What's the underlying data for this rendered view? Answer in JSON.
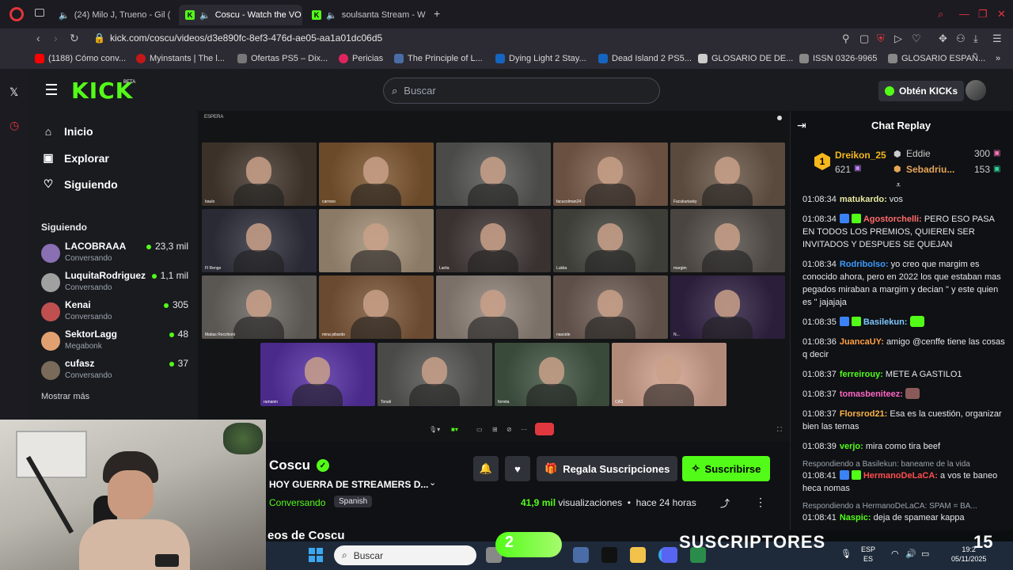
{
  "browser": {
    "tabs": [
      {
        "label": "(24) Milo J, Trueno - Gil (",
        "icon": "youtube-icon"
      },
      {
        "label": "Coscu - Watch the VO",
        "icon": "kick-icon",
        "active": true
      },
      {
        "label": "soulsanta Stream - W",
        "icon": "kick-icon"
      }
    ],
    "new_tab": "+",
    "url": "kick.com/coscu/videos/d3e890fc-8ef3-476d-ae05-aa1a01dc06d5",
    "bookmarks": [
      {
        "label": "(1188) Cómo conv...",
        "color": "#ff0000"
      },
      {
        "label": "Myinstants | The l...",
        "color": "#c41818"
      },
      {
        "label": "Ofertas PS5 – Dix...",
        "color": "#777777"
      },
      {
        "label": "Pericias",
        "color": "#e0245e"
      },
      {
        "label": "The Principle of L...",
        "color": "#4a6da7"
      },
      {
        "label": "Dying Light 2 Stay...",
        "color": "#1565c0"
      },
      {
        "label": "Dead Island 2 PS5...",
        "color": "#1565c0"
      },
      {
        "label": "GLOSARIO DE DE...",
        "color": "#cccccc"
      },
      {
        "label": "ISSN 0326-9965",
        "color": "#888888"
      },
      {
        "label": "GLOSARIO ESPAÑ...",
        "color": "#888888"
      }
    ]
  },
  "kick": {
    "logo": "KICK",
    "beta": "BETA",
    "search_placeholder": "Buscar",
    "get_kicks": "Obtén KICKs",
    "nav": [
      {
        "label": "Inicio",
        "icon": "home-icon"
      },
      {
        "label": "Explorar",
        "icon": "explore-icon"
      },
      {
        "label": "Siguiendo",
        "icon": "heart-icon"
      }
    ],
    "following_label": "Siguiendo",
    "following": [
      {
        "name": "LACOBRAAA",
        "status": "Conversando",
        "viewers": "23,3 mil",
        "color": "#8a6fb2"
      },
      {
        "name": "LuquitaRodriguez",
        "status": "Conversando",
        "viewers": "1,1 mil",
        "color": "#a0a0a0"
      },
      {
        "name": "Kenai",
        "status": "Conversando",
        "viewers": "305",
        "color": "#c05050"
      },
      {
        "name": "SektorLagg",
        "status": "Megabonk",
        "viewers": "48",
        "color": "#e0a070"
      },
      {
        "name": "cufasz",
        "status": "Conversando",
        "viewers": "37",
        "color": "#7a6a5a"
      }
    ],
    "show_more": "Mostrar más"
  },
  "video": {
    "status": "ESPERA",
    "cams": [
      {
        "label": "baulo",
        "color": "#3b3128"
      },
      {
        "label": "carrooo",
        "color": "#6b4a2a"
      },
      {
        "label": "",
        "color": "#4a4a48"
      },
      {
        "label": "facucolman24",
        "color": "#6a5040"
      },
      {
        "label": "Facukuriasky",
        "color": "#5a4a3e"
      },
      {
        "label": "Fl Rengo",
        "color": "#2a2a35"
      },
      {
        "label": "",
        "color": "#8a7a66"
      },
      {
        "label": "Larita",
        "color": "#3a3230"
      },
      {
        "label": "Lukita",
        "color": "#3e3e38"
      },
      {
        "label": "margim",
        "color": "#4a4540"
      },
      {
        "label": "Matias Recchioni",
        "color": "#5a5652"
      },
      {
        "label": "mina pibardo",
        "color": "#6a4a30"
      },
      {
        "label": "",
        "color": "#7a7068"
      },
      {
        "label": "nasoide",
        "color": "#5e5048"
      },
      {
        "label": "N...",
        "color": "#2a1e3a"
      },
      {
        "label": "ramanin",
        "color": "#4a2a8a"
      },
      {
        "label": "Tonali",
        "color": "#4a4a48"
      },
      {
        "label": "forreta",
        "color": "#3a4a3a"
      },
      {
        "label": "CAS",
        "color": "#b28a7a"
      }
    ]
  },
  "channel": {
    "name": "Coscu",
    "title": "HOY GUERRA DE STREAMERS D...",
    "category": "Conversando",
    "language": "Spanish",
    "gift_label": "Regala Suscripciones",
    "subscribe_label": "Suscribirse",
    "views_value": "41,9 mil",
    "views_label": "visualizaciones",
    "ago": "hace 24 horas",
    "more_from": "eos de Coscu"
  },
  "chat": {
    "title": "Chat Replay",
    "leaderboard": [
      {
        "rank": "1",
        "name": "Dreikon_25",
        "value": "621",
        "color": "#f5b81d"
      },
      {
        "name": "Eddie",
        "value": "300",
        "color": "#c8c8c8"
      },
      {
        "name": "Sebadriu...",
        "value": "153",
        "color": "#e5a657"
      }
    ],
    "messages": [
      {
        "time": "01:08:34",
        "user": "matukardo:",
        "color": "#e8e8a0",
        "text": "vos",
        "badges": 0
      },
      {
        "time": "01:08:34",
        "user": "Agostorchelli:",
        "color": "#ff6b6b",
        "text": "PERO ESO PASA EN TODOS LOS PREMIOS, QUIEREN SER INVITADOS Y DESPUES SE QUEJAN",
        "badges": 2
      },
      {
        "time": "01:08:34",
        "user": "Rodribolso:",
        "color": "#3b9cff",
        "text": "yo creo que margim es conocido ahora, pero en 2022 los que estaban mas pegados miraban a margim y decian \" y este quien es \" jajajaja",
        "badges": 0
      },
      {
        "time": "01:08:35",
        "user": "Basilekun:",
        "color": "#7ec8ff",
        "text": "",
        "badges": 2
      },
      {
        "time": "01:08:36",
        "user": "JuancaUY:",
        "color": "#ff9f43",
        "text": "amigo @cenffe tiene las cosas q decir",
        "badges": 0
      },
      {
        "time": "01:08:37",
        "user": "ferreirouy:",
        "color": "#53fc18",
        "text": "METE A GASTILO1",
        "badges": 0
      },
      {
        "time": "01:08:37",
        "user": "tomasbeniteez:",
        "color": "#ff66c4",
        "text": "",
        "badges": 0
      },
      {
        "time": "01:08:37",
        "user": "Florsrod21:",
        "color": "#ffb347",
        "text": "Esa es la cuestión, organizar bien las ternas",
        "badges": 0
      },
      {
        "time": "01:08:39",
        "user": "verjo:",
        "color": "#53fc18",
        "text": "mira como tira beef",
        "badges": 0
      },
      {
        "reply": "Respondiendo a Basilekun: baneame de la vida",
        "time": "01:08:41",
        "user": "HermanoDeLaCA:",
        "color": "#ff4d4d",
        "text": "a vos te baneo heca nomas",
        "badges": 2
      },
      {
        "reply": "Respondiendo a HermanoDeLaCA: SPAM = BA...",
        "time": "01:08:41",
        "user": "Naspic:",
        "color": "#53fc18",
        "text": "deja de spamear kappa",
        "badges": 0
      }
    ]
  },
  "overlay": {
    "sub_count": "2",
    "sub_text": "SUSCRIPTORES",
    "sub_goal": "15",
    "sub_progress": 0.13
  },
  "taskbar": {
    "search_placeholder": "Buscar",
    "lang_top": "ESP",
    "lang_bottom": "ES",
    "time": "19:2",
    "date": "05/11/2025"
  }
}
